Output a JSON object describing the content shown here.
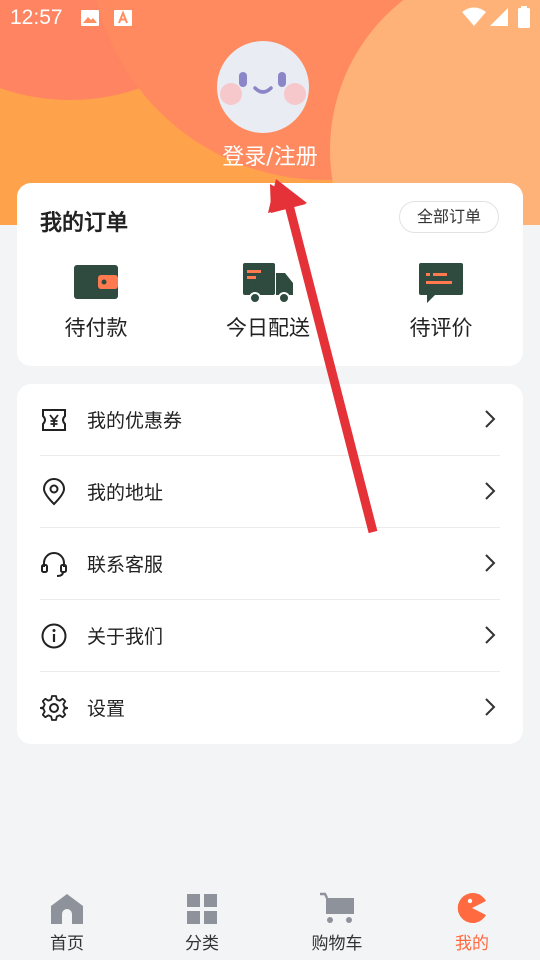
{
  "status_bar": {
    "time": "12:57",
    "icons": [
      "image-icon",
      "a-app-icon",
      "wifi-icon",
      "signal-icon",
      "battery-icon"
    ]
  },
  "profile": {
    "avatar": "smiley-avatar",
    "login_text": "登录/注册"
  },
  "orders": {
    "title": "我的订单",
    "all_label": "全部订单",
    "items": [
      {
        "label": "待付款",
        "icon": "wallet-icon"
      },
      {
        "label": "今日配送",
        "icon": "truck-icon"
      },
      {
        "label": "待评价",
        "icon": "comment-icon"
      }
    ]
  },
  "menu": {
    "items": [
      {
        "label": "我的优惠券",
        "icon": "coupon-icon"
      },
      {
        "label": "我的地址",
        "icon": "location-icon"
      },
      {
        "label": "联系客服",
        "icon": "headset-icon"
      },
      {
        "label": "关于我们",
        "icon": "info-icon"
      },
      {
        "label": "设置",
        "icon": "gear-icon"
      }
    ]
  },
  "tabbar": {
    "items": [
      {
        "label": "首页",
        "icon": "home-icon",
        "active": false
      },
      {
        "label": "分类",
        "icon": "grid-icon",
        "active": false
      },
      {
        "label": "购物车",
        "icon": "cart-icon",
        "active": false
      },
      {
        "label": "我的",
        "icon": "pacman-icon",
        "active": true
      }
    ]
  },
  "colors": {
    "accent": "#ff6a40",
    "header_orange": "#ffa24c",
    "icon_dark": "#2f4a3f",
    "icon_accent": "#ff7a4f",
    "arrow_red": "#e53238"
  }
}
